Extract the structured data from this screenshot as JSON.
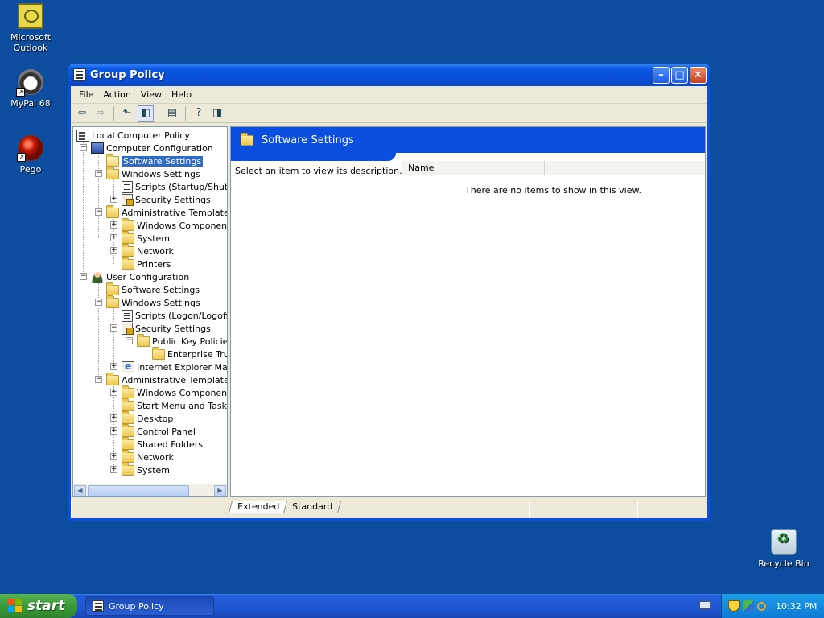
{
  "desktop": {
    "icons": [
      {
        "label": "Microsoft Outlook",
        "icon": "outlook-icon"
      },
      {
        "label": "MyPal 68",
        "icon": "mypal-icon"
      },
      {
        "label": "Pego",
        "icon": "pego-icon"
      },
      {
        "label": "Recycle Bin",
        "icon": "recycle-bin-icon"
      }
    ]
  },
  "window": {
    "title": "Group Policy",
    "menu": [
      "File",
      "Action",
      "View",
      "Help"
    ],
    "tree": {
      "root": "Local Computer Policy",
      "computer_config": "Computer Configuration",
      "cc_software_settings": "Software Settings",
      "cc_windows_settings": "Windows Settings",
      "cc_scripts": "Scripts (Startup/Shutdown)",
      "cc_security_settings": "Security Settings",
      "cc_admin_templates": "Administrative Templates",
      "cc_windows_components": "Windows Components",
      "cc_system": "System",
      "cc_network": "Network",
      "cc_printers": "Printers",
      "user_config": "User Configuration",
      "uc_software_settings": "Software Settings",
      "uc_windows_settings": "Windows Settings",
      "uc_scripts": "Scripts (Logon/Logoff)",
      "uc_security_settings": "Security Settings",
      "uc_public_key_policies": "Public Key Policies",
      "uc_enterprise_trust": "Enterprise Trust",
      "uc_ie_maintenance": "Internet Explorer Maintenance",
      "uc_admin_templates": "Administrative Templates",
      "uc_windows_components": "Windows Components",
      "uc_start_menu": "Start Menu and Taskbar",
      "uc_desktop": "Desktop",
      "uc_control_panel": "Control Panel",
      "uc_shared_folders": "Shared Folders",
      "uc_network": "Network",
      "uc_system": "System"
    },
    "right": {
      "heading": "Software Settings",
      "description": "Select an item to view its description.",
      "column_name": "Name",
      "empty_message": "There are no items to show in this view."
    },
    "tabs": [
      "Extended",
      "Standard"
    ]
  },
  "taskbar": {
    "start_label": "start",
    "task_title": "Group Policy",
    "clock": "10:32 PM"
  }
}
